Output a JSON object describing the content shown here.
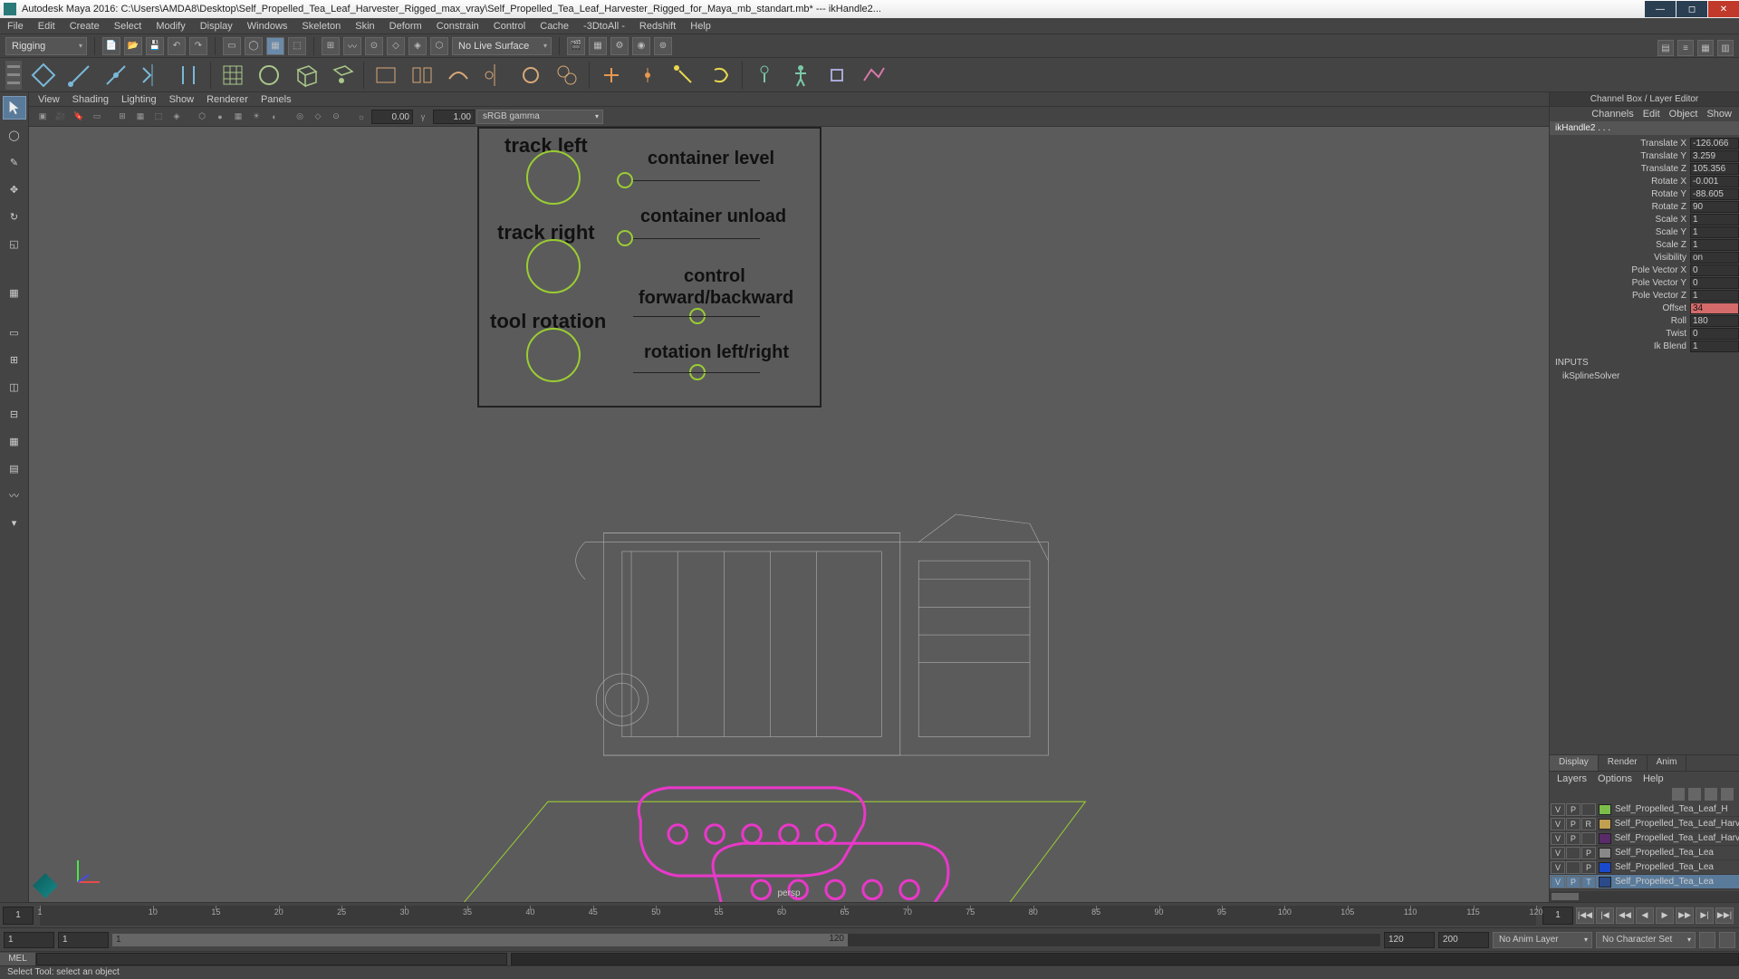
{
  "titlebar": {
    "title": "Autodesk Maya 2016: C:\\Users\\AMDA8\\Desktop\\Self_Propelled_Tea_Leaf_Harvester_Rigged_max_vray\\Self_Propelled_Tea_Leaf_Harvester_Rigged_for_Maya_mb_standart.mb*  ---  ikHandle2..."
  },
  "menubar": [
    "File",
    "Edit",
    "Create",
    "Select",
    "Modify",
    "Display",
    "Windows",
    "Skeleton",
    "Skin",
    "Deform",
    "Constrain",
    "Control",
    "Cache",
    "-3DtoAll -",
    "Redshift",
    "Help"
  ],
  "toolbar": {
    "mode_dropdown": "Rigging",
    "live_surface": "No Live Surface"
  },
  "viewport_menus": [
    "View",
    "Shading",
    "Lighting",
    "Show",
    "Renderer",
    "Panels"
  ],
  "viewport_toolbar": {
    "num1": "0.00",
    "num2": "1.00",
    "colorspace": "sRGB gamma"
  },
  "rig_controls": {
    "track_left": "track left",
    "track_right": "track right",
    "tool_rotation": "tool rotation",
    "container_level": "container level",
    "container_unload": "container unload",
    "control_forward_backward_1": "control",
    "control_forward_backward_2": "forward/backward",
    "rotation_left_right": "rotation left/right"
  },
  "viewport": {
    "camera_label": "persp"
  },
  "channelbox": {
    "header": "Channel Box / Layer Editor",
    "tabs": [
      "Channels",
      "Edit",
      "Object",
      "Show"
    ],
    "object": "ikHandle2 . . .",
    "attrs": [
      {
        "label": "Translate X",
        "value": "-126.066"
      },
      {
        "label": "Translate Y",
        "value": "3.259"
      },
      {
        "label": "Translate Z",
        "value": "105.356"
      },
      {
        "label": "Rotate X",
        "value": "-0.001"
      },
      {
        "label": "Rotate Y",
        "value": "-88.605"
      },
      {
        "label": "Rotate Z",
        "value": "90"
      },
      {
        "label": "Scale X",
        "value": "1"
      },
      {
        "label": "Scale Y",
        "value": "1"
      },
      {
        "label": "Scale Z",
        "value": "1"
      },
      {
        "label": "Visibility",
        "value": "on"
      },
      {
        "label": "Pole Vector X",
        "value": "0"
      },
      {
        "label": "Pole Vector Y",
        "value": "0"
      },
      {
        "label": "Pole Vector Z",
        "value": "1"
      },
      {
        "label": "Offset",
        "value": "34",
        "highlight": true
      },
      {
        "label": "Roll",
        "value": "180"
      },
      {
        "label": "Twist",
        "value": "0"
      },
      {
        "label": "Ik Blend",
        "value": "1"
      }
    ],
    "inputs_header": "INPUTS",
    "inputs_node": "ikSplineSolver"
  },
  "layer_editor": {
    "tabs": [
      "Display",
      "Render",
      "Anim"
    ],
    "active_tab": "Display",
    "menu": [
      "Layers",
      "Options",
      "Help"
    ],
    "layers": [
      {
        "v": "V",
        "p": "P",
        "r": "",
        "color": "#7bbf4a",
        "name": "Self_Propelled_Tea_Leaf_H"
      },
      {
        "v": "V",
        "p": "P",
        "r": "R",
        "color": "#c0a050",
        "name": "Self_Propelled_Tea_Leaf_Harv"
      },
      {
        "v": "V",
        "p": "P",
        "r": "",
        "color": "#5a2a6a",
        "name": "Self_Propelled_Tea_Leaf_Harv"
      },
      {
        "v": "V",
        "p": "",
        "r": "P",
        "color": "#888888",
        "name": "Self_Propelled_Tea_Lea"
      },
      {
        "v": "V",
        "p": "",
        "r": "P",
        "color": "#1a4acc",
        "name": "Self_Propelled_Tea_Lea"
      },
      {
        "v": "V",
        "p": "P",
        "r": "T",
        "color": "#2a4a8a",
        "name": "Self_Propelled_Tea_Lea",
        "selected": true
      }
    ]
  },
  "timeslider": {
    "start_field": "1",
    "end_field": "1",
    "ticks": [
      1,
      10,
      15,
      20,
      25,
      30,
      35,
      40,
      45,
      50,
      55,
      60,
      65,
      70,
      75,
      80,
      85,
      90,
      95,
      100,
      105,
      110,
      115,
      120
    ]
  },
  "rangeslider": {
    "anim_start": "1",
    "range_start": "1",
    "range_label": "1",
    "range_end": "120",
    "anim_end_1": "120",
    "anim_end_2": "200",
    "anim_layer": "No Anim Layer",
    "char_set": "No Character Set"
  },
  "cmdline": {
    "lang": "MEL"
  },
  "helpline": {
    "text": "Select Tool: select an object"
  },
  "playback_icons": [
    "|◀◀",
    "|◀",
    "◀◀",
    "◀",
    "▶",
    "▶▶",
    "▶|",
    "▶▶|"
  ]
}
